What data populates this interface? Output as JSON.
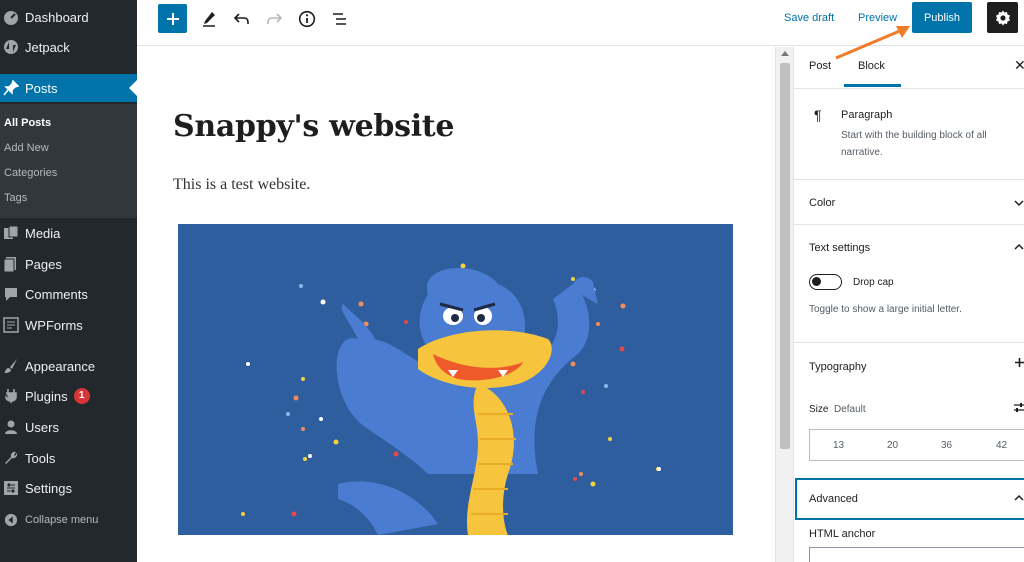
{
  "admin_menu": {
    "items": [
      {
        "label": "Dashboard",
        "icon": "dashboard-icon"
      },
      {
        "label": "Jetpack",
        "icon": "jetpack-icon"
      },
      {
        "label": "Posts",
        "icon": "pin-icon"
      },
      {
        "label": "Media",
        "icon": "media-icon"
      },
      {
        "label": "Pages",
        "icon": "pages-icon"
      },
      {
        "label": "Comments",
        "icon": "comment-icon"
      },
      {
        "label": "WPForms",
        "icon": "forms-icon"
      },
      {
        "label": "Appearance",
        "icon": "brush-icon"
      },
      {
        "label": "Plugins",
        "icon": "plugin-icon",
        "badge": "1"
      },
      {
        "label": "Users",
        "icon": "users-icon"
      },
      {
        "label": "Tools",
        "icon": "wrench-icon"
      },
      {
        "label": "Settings",
        "icon": "settings-icon"
      }
    ],
    "submenu": [
      "All Posts",
      "Add New",
      "Categories",
      "Tags"
    ],
    "collapse_label": "Collapse menu"
  },
  "toolbar": {
    "save_draft": "Save draft",
    "preview": "Preview",
    "publish": "Publish"
  },
  "post": {
    "title": "Snappy's website",
    "paragraph": "This is a test website."
  },
  "panel": {
    "tabs": [
      "Post",
      "Block"
    ],
    "active_tab": "Block",
    "block_name": "Paragraph",
    "block_desc_1": "Start with the building block of all",
    "block_desc_2": "narrative.",
    "color": "Color",
    "text_settings": "Text settings",
    "drop_cap": "Drop cap",
    "drop_cap_help": "Toggle to show a large initial letter.",
    "typography": "Typography",
    "size_label": "Size",
    "size_value": "Default",
    "font_sizes": [
      "13",
      "20",
      "36",
      "42"
    ],
    "advanced": "Advanced",
    "html_anchor": "HTML anchor"
  },
  "colors": {
    "accent": "#0073aa",
    "sidebar_bg": "#23282d",
    "image_bg": "#2f5e9e",
    "annotation": "#f07b2a"
  }
}
